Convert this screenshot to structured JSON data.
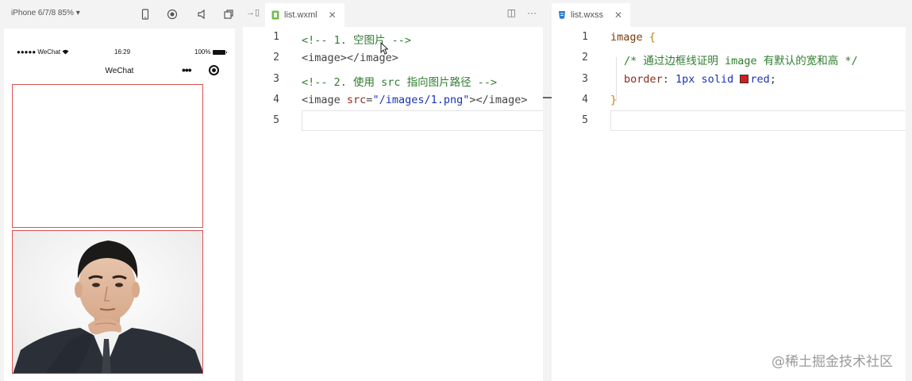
{
  "simulator": {
    "device_label": "iPhone 6/7/8 85% ▾",
    "status": {
      "carrier": "●●●●● WeChat",
      "time": "16:29",
      "battery": "100%"
    },
    "nav_title": "WeChat",
    "capsule_more": "•••"
  },
  "editor_wxml": {
    "tab_label": "list.wxml",
    "tab_close": "✕",
    "actions": [
      "◫",
      "···"
    ],
    "line_numbers": [
      "1",
      "2",
      "3",
      "4",
      "5"
    ],
    "lines": [
      "<!-- 1. 空图片 -->",
      "<image></image>",
      "<!-- 2. 使用 src 指向图片路径 -->",
      "<image src=\"/images/1.png\"></image>",
      ""
    ],
    "code": {
      "l1": "<!-- 1. 空图片 -->",
      "l2": "<image></image>",
      "l3": "<!-- 2. 使用 src 指向图片路径 -->",
      "l4_open": "<image ",
      "l4_attr": "src",
      "l4_eq": "=",
      "l4_str": "\"/images/1.png\"",
      "l4_close": "></image>"
    }
  },
  "editor_wxss": {
    "tab_label": "list.wxss",
    "tab_close": "✕",
    "line_numbers": [
      "1",
      "2",
      "3",
      "4",
      "5"
    ],
    "lines": [
      "image {",
      "  /* 通过边框线证明 image 有默认的宽和高 */",
      "  border: 1px solid red;",
      "}",
      ""
    ],
    "code": {
      "selector": "image",
      "brace_open": " {",
      "comment": "/* 通过边框线证明 image 有默认的宽和高 */",
      "prop": "border",
      "colon": ": ",
      "val1": "1px solid ",
      "val2": "red",
      "semi": ";",
      "brace_close": "}"
    }
  },
  "watermark": "@稀土掘金技术社区",
  "colors": {
    "border_red": "#e05050",
    "comment": "#2f7d2f",
    "string": "#1b34b4",
    "swatch": "#d61c1c"
  }
}
